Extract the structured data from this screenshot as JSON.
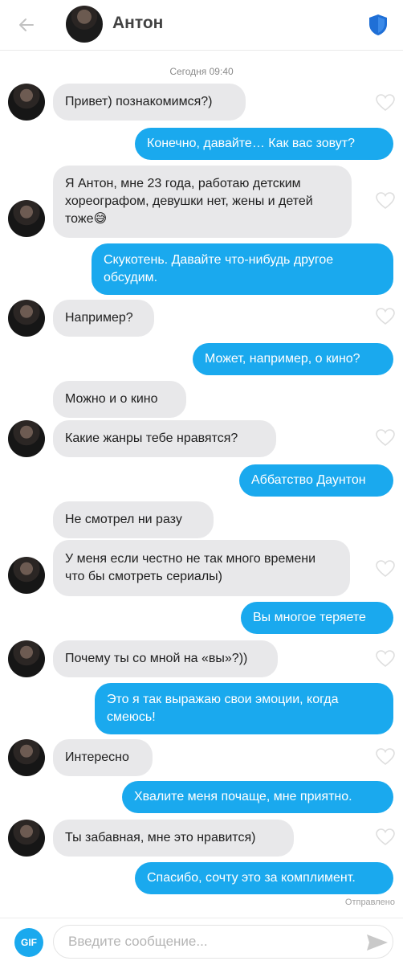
{
  "header": {
    "back_icon": "arrow-left-icon",
    "name": "Антон",
    "badge_icon": "shield-icon",
    "accent": "#1aa9ee"
  },
  "chat": {
    "date_label": "Сегодня 09:40",
    "messages": [
      {
        "from": "them",
        "text": "Привет) познакомимся?)"
      },
      {
        "from": "me",
        "text": "Конечно, давайте… Как вас зовут?"
      },
      {
        "from": "them",
        "text": "Я Антон, мне 23 года, работаю детским хореографом, девушки нет, жены и детей тоже😅"
      },
      {
        "from": "me",
        "text": "Скукотень. Давайте что-нибудь другое обсудим."
      },
      {
        "from": "them",
        "text": "Например?"
      },
      {
        "from": "me",
        "text": "Может, например, о кино?"
      },
      {
        "from": "them",
        "text": "Можно и о кино"
      },
      {
        "from": "them",
        "text": "Какие жанры тебе нравятся?"
      },
      {
        "from": "me",
        "text": "Аббатство Даунтон"
      },
      {
        "from": "them",
        "text": "Не смотрел ни разу"
      },
      {
        "from": "them",
        "text": "У меня если честно не так много времени что бы смотреть сериалы)"
      },
      {
        "from": "me",
        "text": "Вы многое теряете"
      },
      {
        "from": "them",
        "text": "Почему ты со мной на «вы»?))"
      },
      {
        "from": "me",
        "text": "Это я так выражаю свои эмоции, когда смеюсь!"
      },
      {
        "from": "them",
        "text": "Интересно"
      },
      {
        "from": "me",
        "text": "Хвалите меня почаще, мне приятно."
      },
      {
        "from": "them",
        "text": "Ты забавная, мне это нравится)"
      },
      {
        "from": "me",
        "text": "Спасибо, сочту это за комплимент."
      }
    ],
    "status": "Отправлено"
  },
  "composer": {
    "gif_label": "GIF",
    "placeholder": "Введите сообщение...",
    "send_icon": "send-icon"
  }
}
